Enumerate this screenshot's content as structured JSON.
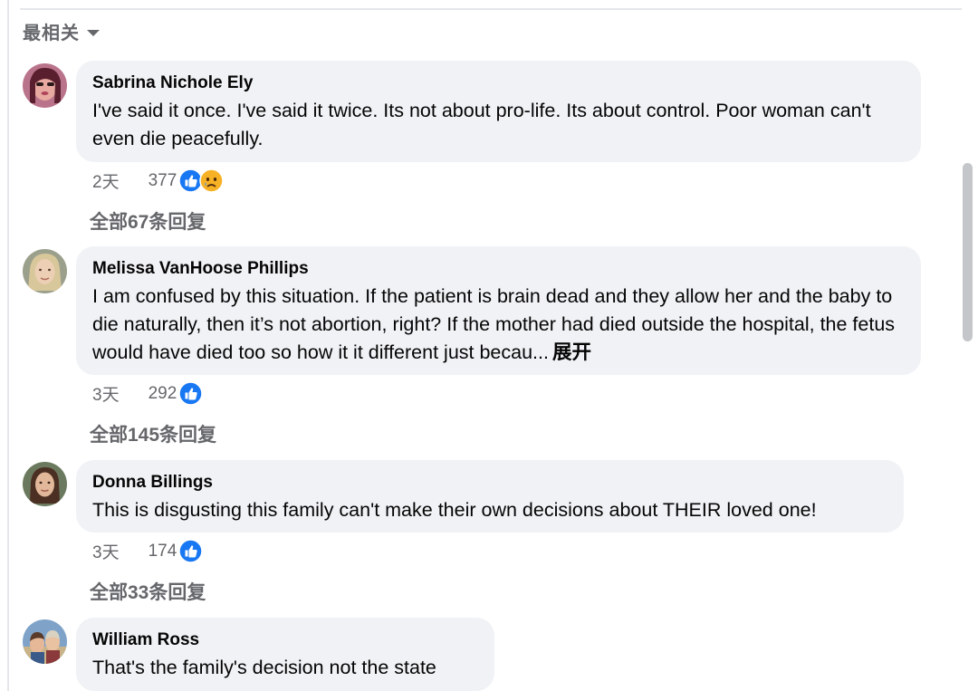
{
  "sort": {
    "label": "最相关"
  },
  "comments": [
    {
      "author": "Sabrina Nichole Ely",
      "text": "I've said it once. I've said it twice. Its not about pro-life. Its about control. Poor woman can't even die peacefully.",
      "time": "2天",
      "reaction_count": "377",
      "reactions": [
        "like-icon",
        "sad-icon"
      ],
      "replies": "全部67条回复"
    },
    {
      "author": "Melissa VanHoose Phillips",
      "text": "I am confused by this situation. If the patient is brain dead and they allow her and the baby to die naturally, then it’s not abortion, right? If the mother had died outside the hospital, the fetus would have died too so how it it different just becau...",
      "see_more": "展开",
      "time": "3天",
      "reaction_count": "292",
      "reactions": [
        "like-icon"
      ],
      "replies": "全部145条回复"
    },
    {
      "author": "Donna Billings",
      "text": "This is disgusting this family can't make their own decisions about THEIR loved one!",
      "time": "3天",
      "reaction_count": "174",
      "reactions": [
        "like-icon"
      ],
      "replies": "全部33条回复"
    },
    {
      "author": "William Ross",
      "text": "That's the family's decision not the state"
    }
  ],
  "colors": {
    "bubble": "#f0f2f5",
    "secondary_text": "#65676b",
    "like_blue": "#1877f2",
    "sad_yellow": "#f7b125"
  }
}
